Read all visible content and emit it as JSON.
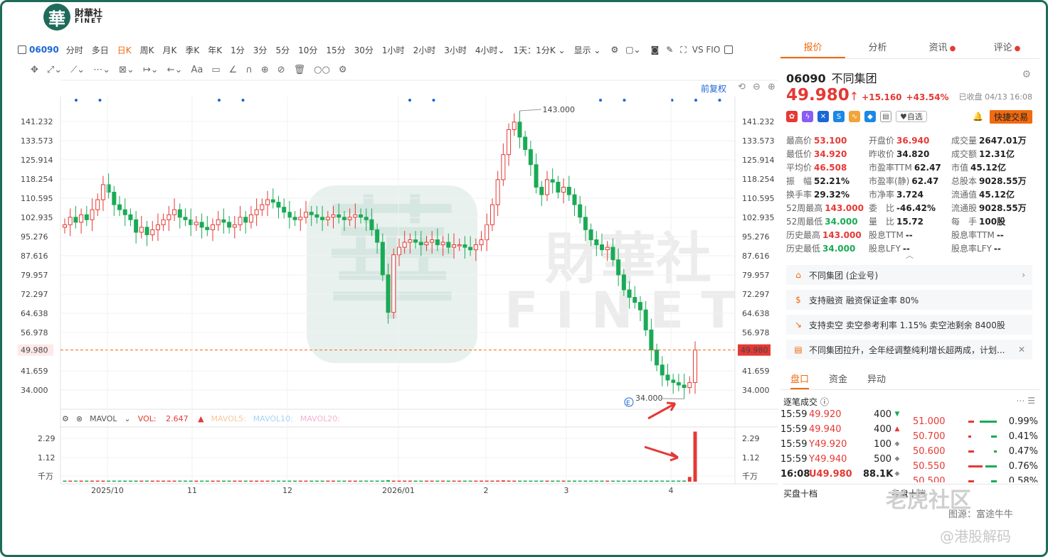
{
  "logo": {
    "seal": "華",
    "cn": "財華社",
    "en": "FINET"
  },
  "toolbar": {
    "code": "06090",
    "periods": [
      "分时",
      "多日",
      "日K",
      "周K",
      "月K",
      "季K",
      "年K",
      "1分",
      "3分",
      "5分",
      "10分",
      "15分",
      "30分",
      "1小时",
      "2小时",
      "3小时",
      "4小时⌄",
      "1天：1分K ⌄",
      "显示 ⌄"
    ],
    "active_period": "日K",
    "right": "VS FIO"
  },
  "draw_tools": [
    "✥",
    "⤢⌄",
    "⟋⌄",
    "⋯⌄",
    "⊠⌄",
    "↦⌄",
    "←⌄",
    "Aa",
    "▭",
    "∠",
    "∩",
    "⊕",
    "⊘",
    "🗑",
    "○○",
    "⚙"
  ],
  "chart_header": {
    "adjust": "前复权",
    "controls": "⟲ ⊖ ⊕"
  },
  "chart_data": {
    "type": "candlestick",
    "y_ticks": [
      "141.232",
      "133.573",
      "125.914",
      "118.254",
      "110.595",
      "102.935",
      "95.276",
      "87.616",
      "79.957",
      "72.297",
      "64.638",
      "56.978",
      "41.659",
      "34.000"
    ],
    "y_tick_values": [
      141.232,
      133.573,
      125.914,
      118.254,
      110.595,
      102.935,
      95.276,
      87.616,
      79.957,
      72.297,
      64.638,
      56.978,
      41.659,
      34.0
    ],
    "current_price_label": "49.980",
    "current_price": 49.98,
    "high_label": "143.000",
    "low_label": "34.000",
    "x_labels": [
      "2025/10",
      "11",
      "12",
      "2026/01",
      "2",
      "3",
      "4"
    ],
    "vol_ticks": [
      "2.29",
      "1.12",
      "千万"
    ],
    "close": [
      100,
      103,
      101,
      104,
      102,
      106,
      110,
      116,
      113,
      108,
      106,
      104,
      102,
      97,
      99,
      96,
      98,
      100,
      102,
      104,
      106,
      103,
      102,
      100,
      101,
      99,
      98,
      100,
      102,
      101,
      99,
      100,
      103,
      101,
      104,
      106,
      108,
      110,
      109,
      107,
      105,
      103,
      102,
      103,
      105,
      104,
      103,
      102,
      103,
      104,
      103,
      102,
      103,
      104,
      103,
      102,
      98,
      93,
      80,
      65,
      88,
      91,
      93,
      94,
      93,
      92,
      93,
      94,
      92,
      93,
      91,
      92,
      92,
      91,
      90,
      92,
      94,
      100,
      108,
      118,
      128,
      138,
      141,
      135,
      130,
      124,
      115,
      112,
      118,
      117,
      113,
      115,
      112,
      108,
      103,
      98,
      94,
      92,
      90,
      91,
      86,
      80,
      74,
      71,
      69,
      66,
      58,
      50,
      44,
      40,
      38,
      37,
      36,
      35,
      37,
      49.98
    ],
    "vol": [
      0.05,
      0.03,
      0.02,
      0.02,
      0.02,
      0.03,
      0.02,
      0.03,
      0.02,
      0.02,
      0.02,
      0.03,
      0.02,
      0.03,
      0.02,
      0.02,
      0.02,
      0.02,
      0.03,
      0.02,
      0.02,
      0.02,
      0.02,
      0.02,
      0.02,
      0.02,
      0.02,
      0.02,
      0.02,
      0.02,
      0.02,
      0.02,
      0.03,
      0.02,
      0.02,
      0.03,
      0.03,
      0.02,
      0.02,
      0.02,
      0.02,
      0.02,
      0.02,
      0.02,
      0.02,
      0.02,
      0.02,
      0.02,
      0.02,
      0.02,
      0.02,
      0.02,
      0.02,
      0.02,
      0.02,
      0.02,
      0.04,
      0.04,
      0.06,
      0.08,
      0.05,
      0.03,
      0.02,
      0.02,
      0.02,
      0.02,
      0.02,
      0.02,
      0.02,
      0.02,
      0.02,
      0.02,
      0.02,
      0.02,
      0.02,
      0.02,
      0.03,
      0.04,
      0.05,
      0.06,
      0.07,
      0.06,
      0.05,
      0.04,
      0.04,
      0.04,
      0.04,
      0.03,
      0.03,
      0.03,
      0.03,
      0.03,
      0.03,
      0.03,
      0.03,
      0.03,
      0.03,
      0.03,
      0.03,
      0.03,
      0.03,
      0.04,
      0.04,
      0.04,
      0.04,
      0.04,
      0.05,
      0.05,
      0.05,
      0.05,
      0.05,
      0.05,
      0.05,
      0.06,
      0.25,
      2.647
    ],
    "colors": {
      "up": "#e53935",
      "down": "#1aaa55"
    }
  },
  "watermark": {
    "cn": "財華社",
    "en": "FINET"
  },
  "vol_header": {
    "name": "MAVOL",
    "vol_label": "VOL:",
    "vol_value": "2.647",
    "ma5": "MAVOL5:",
    "ma10": "MAVOL10:",
    "ma20": "MAVOL20:"
  },
  "right_panel": {
    "tabs": [
      "报价",
      "分析",
      "资讯",
      "评论"
    ],
    "code": "06090",
    "name": "不同集团",
    "price": "49.980",
    "change": "+15.160",
    "change_pct": "+43.54%",
    "close_note": "已收盘 04/13 16:08",
    "zixuan": "♥自选",
    "quick_trade": "快捷交易",
    "stats": [
      [
        [
          "最高价",
          "53.100",
          "red"
        ],
        [
          "开盘价",
          "36.940",
          "red"
        ],
        [
          "成交量",
          "2647.01万",
          ""
        ]
      ],
      [
        [
          "最低价",
          "34.920",
          "red"
        ],
        [
          "昨收价",
          "34.820",
          ""
        ],
        [
          "成交额",
          "12.31亿",
          ""
        ]
      ],
      [
        [
          "平均价",
          "46.508",
          "red"
        ],
        [
          "市盈率TTM",
          "62.47",
          ""
        ],
        [
          "市值",
          "45.12亿",
          ""
        ]
      ],
      [
        [
          "振　幅",
          "52.21%",
          ""
        ],
        [
          "市盈率(静)",
          "62.47",
          ""
        ],
        [
          "总股本",
          "9028.55万",
          ""
        ]
      ],
      [
        [
          "换手率",
          "29.32%",
          ""
        ],
        [
          "市净率",
          "3.724",
          ""
        ],
        [
          "流通值",
          "45.12亿",
          ""
        ]
      ],
      [
        [
          "52周最高",
          "143.000",
          "red"
        ],
        [
          "委　比",
          "-46.42%",
          ""
        ],
        [
          "流通股",
          "9028.55万",
          ""
        ]
      ],
      [
        [
          "52周最低",
          "34.000",
          "grn"
        ],
        [
          "量　比",
          "15.72",
          ""
        ],
        [
          "每　手",
          "100股",
          ""
        ]
      ],
      [
        [
          "历史最高",
          "143.000",
          "red"
        ],
        [
          "股息TTM",
          "--",
          ""
        ],
        [
          "股息率TTM",
          "--",
          ""
        ]
      ],
      [
        [
          "历史最低",
          "34.000",
          "grn"
        ],
        [
          "股息LFY",
          "--",
          ""
        ],
        [
          "股息率LFY",
          "--",
          ""
        ]
      ]
    ],
    "info": [
      {
        "icon": "⌂",
        "text": "不同集团 (企业号)",
        "end": "›"
      },
      {
        "icon": "$",
        "text": "支持融资  融资保证金率 80%",
        "end": ""
      },
      {
        "icon": "↘",
        "text": "支持卖空  卖空参考利率 1.15%  卖空池剩余 8400股",
        "end": ""
      },
      {
        "icon": "▤",
        "text": "不同集团拉升，全年经调整纯利增长超两成，计划...",
        "end": "✕"
      }
    ],
    "bottom_tabs": [
      "盘口",
      "资金",
      "异动"
    ],
    "ticks_title": "逐笔成交 ⓘ",
    "ticks_icons": "⋯ ☰",
    "ticks": [
      [
        "15:59",
        "49.920",
        "400",
        "▼"
      ],
      [
        "15:59",
        "49.940",
        "400",
        "▲"
      ],
      [
        "15:59",
        "Y49.920",
        "100",
        "◆"
      ],
      [
        "15:59",
        "Y49.940",
        "500",
        "◆"
      ],
      [
        "16:08",
        "U49.980",
        "88.1K",
        "◆"
      ]
    ],
    "depth": [
      [
        "51.000",
        "0.99%",
        0.2,
        0.6
      ],
      [
        "50.700",
        "0.41%",
        0.1,
        0.2
      ],
      [
        "50.600",
        "0.47%",
        0.2,
        0.1
      ],
      [
        "50.550",
        "0.76%",
        0.5,
        0.4
      ],
      [
        "50.500",
        "0.58%",
        0.2,
        0.2
      ]
    ],
    "buy10": "买盘十档",
    "sell10": "卖盘十档"
  },
  "footer": {
    "tiger": "老虎社区",
    "source": "图源：富途牛牛",
    "handle": "@港股解码"
  }
}
